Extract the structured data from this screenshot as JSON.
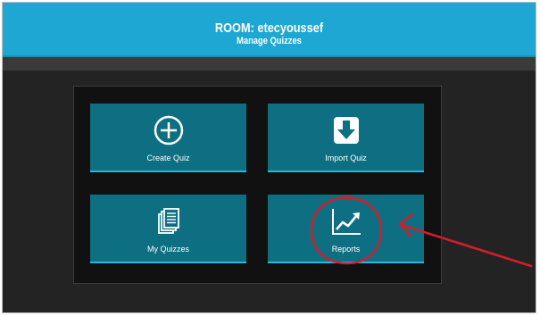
{
  "header": {
    "room_title": "ROOM: etecyoussef",
    "subtitle": "Manage Quizzes"
  },
  "tiles": [
    {
      "label": "Create Quiz",
      "icon": "plus-circle-icon"
    },
    {
      "label": "Import Quiz",
      "icon": "download-icon"
    },
    {
      "label": "My Quizzes",
      "icon": "documents-icon"
    },
    {
      "label": "Reports",
      "icon": "line-chart-icon"
    }
  ],
  "colors": {
    "header": "#1ea7d2",
    "tile": "#0e6f82",
    "tile_accent": "#26b6de",
    "annotation": "#d21e2b"
  }
}
